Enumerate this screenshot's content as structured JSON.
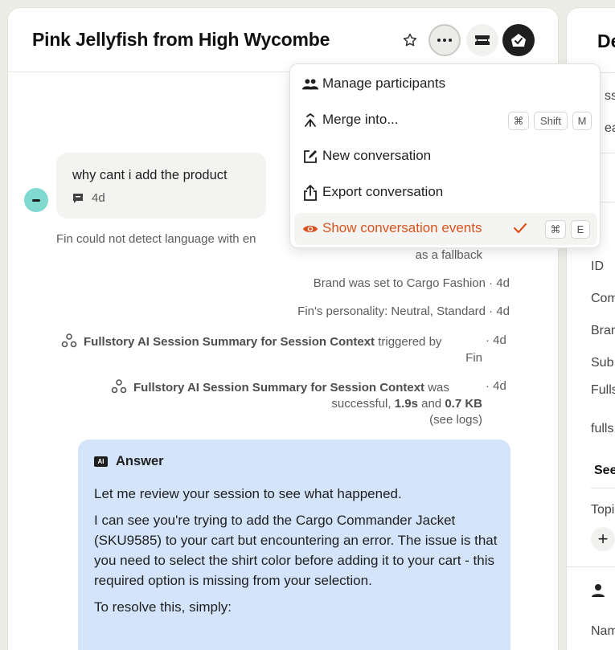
{
  "header": {
    "title": "Pink Jellyfish from High Wycombe"
  },
  "message": {
    "text": "why cant i add the product",
    "time": "4d"
  },
  "events": {
    "language_line1": "Fin could not detect language with en",
    "language_line2": "as a fallback",
    "brand": "Brand was set to Cargo Fashion · 4d",
    "personality": "Fin's personality: Neutral, Standard · 4d",
    "trigger_name": "Fullstory AI Session Summary for Session Context",
    "trigger_suffix": " triggered by",
    "trigger_by": "Fin",
    "trigger_time": "· 4d",
    "success_name": "Fullstory AI Session Summary for Session Context",
    "success_was": " was",
    "success_line2_a": "successful, ",
    "success_dur": "1.9s",
    "success_and": " and ",
    "success_size": "0.7 KB",
    "success_line3": "(see logs)",
    "success_time": "· 4d"
  },
  "answer": {
    "badge": "AI",
    "label": "Answer",
    "p1": "Let me review your session to see what happened.",
    "p2": "I can see you're trying to add the Cargo Commander Jacket (SKU9585) to your cart but encountering an error. The issue is that you need to select the shirt color before adding it to your cart - this required option is missing from your selection.",
    "p3": "To resolve this, simply:"
  },
  "menu": {
    "items": [
      {
        "label": "Manage participants",
        "icon": "people-icon"
      },
      {
        "label": "Merge into...",
        "icon": "merge-icon",
        "keys": [
          "⌘",
          "Shift",
          "M"
        ]
      },
      {
        "label": "New conversation",
        "icon": "compose-icon"
      },
      {
        "label": "Export conversation",
        "icon": "export-icon"
      },
      {
        "label": "Show conversation events",
        "icon": "eye-icon",
        "keys": [
          "⌘",
          "E"
        ],
        "checked": true
      }
    ],
    "accent": "#d9531e"
  },
  "right_panel": {
    "title": "De",
    "t1": "ssi",
    "t2": "ear",
    "id": "ID",
    "f1": "Com",
    "f2": "Bran",
    "f3": "Sub",
    "f4": "Fulls",
    "f5": "fulls",
    "see": "See",
    "topic": "Topi",
    "add": "+",
    "name": "Nam"
  }
}
